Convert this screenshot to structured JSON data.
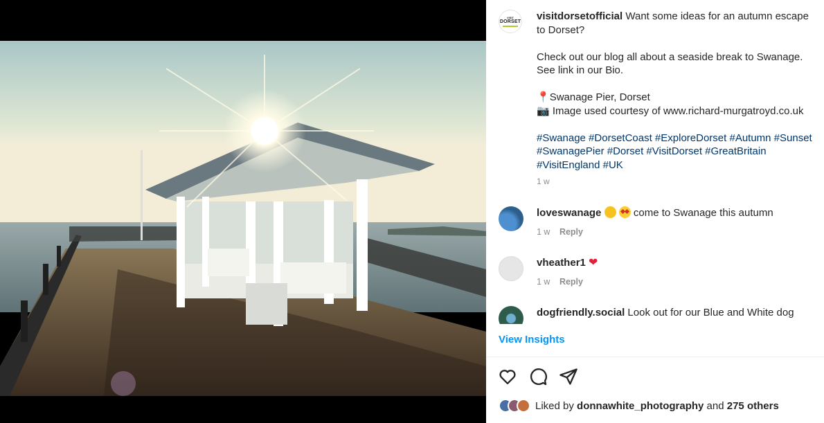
{
  "post": {
    "username": "visitdorsetofficial",
    "brand_logo": {
      "line1": "VISIT",
      "line2": "DORSET"
    },
    "caption_lines": [
      "Want some ideas for an autumn escape to Dorset?"
    ],
    "blog_line": "Check out our blog all about a seaside break to Swanage. See link in our Bio.",
    "location_icon": "pin-emoji",
    "location_line": "Swanage Pier, Dorset",
    "camera_icon": "camera-emoji",
    "credit_line": "Image used courtesy of www.richard-murgatroyd.co.uk",
    "hashtags": "#Swanage #DorsetCoast #ExploreDorset #Autumn #Sunset #SwanagePier #Dorset #VisitDorset #GreatBritain #VisitEngland #UK",
    "time": "1 w"
  },
  "comments": [
    {
      "username": "loveswanage",
      "emoji_1": "clapping-hands",
      "emoji_2": "star-struck",
      "text": "come to Swanage this autumn",
      "time": "1 w",
      "reply_label": "Reply",
      "avatar_color": "#3f7fb5"
    },
    {
      "username": "vheather1",
      "emoji": "red-heart",
      "heart_glyph": "❤",
      "text": "",
      "time": "1 w",
      "reply_label": "Reply",
      "avatar_color": "#e6e6e6"
    },
    {
      "username": "dogfriendly.social",
      "text": "Look out for our Blue and White dog",
      "avatar_color": "#2e5c4a"
    }
  ],
  "view_insights_label": "View Insights",
  "actions": {
    "like_icon": "heart-icon",
    "comment_icon": "comment-icon",
    "share_icon": "share-icon"
  },
  "likes": {
    "prefix": "Liked by",
    "user": "donnawhite_photography",
    "and_label": "and",
    "count": "275 others",
    "avatar_colors": [
      "#4a6fa5",
      "#8a5a6e",
      "#c4703e"
    ]
  },
  "colors": {
    "link": "#0095f6",
    "hashtag": "#00376b",
    "secondary": "#8e8e8e"
  }
}
